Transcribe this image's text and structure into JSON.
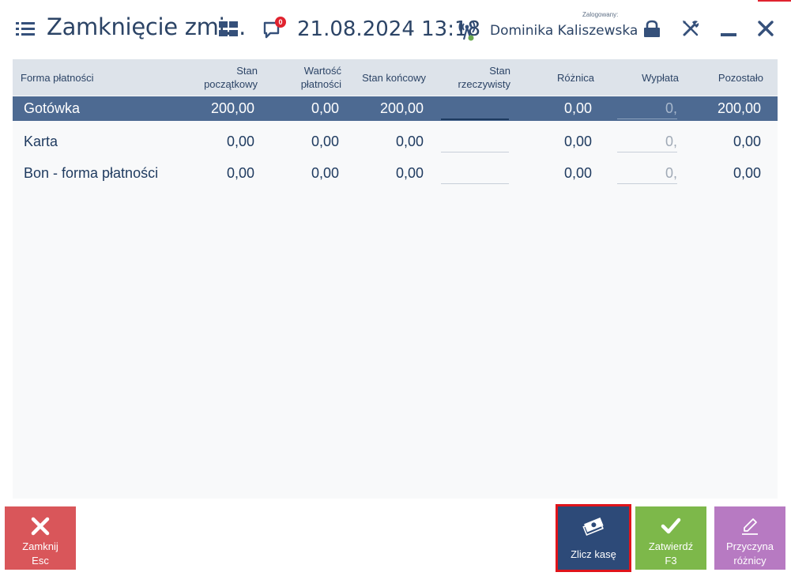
{
  "header": {
    "title": "Zamknięcie zmi...",
    "datetime": "21.08.2024 13:18",
    "notifications_count": "0",
    "logged_label": "Zalogowany:",
    "user_name": "Dominika Kaliszewska",
    "icons": [
      "menu-icon",
      "tiles-icon",
      "notifications-icon",
      "connection-icon",
      "lock-icon",
      "tools-icon",
      "minimize-icon",
      "close-icon"
    ],
    "status_color": "#6aa84f"
  },
  "table": {
    "columns": [
      "Forma płatności",
      "Stan początkowy",
      "Wartość płatności",
      "Stan końcowy",
      "Stan rzeczywisty",
      "Różnica",
      "Wypłata",
      "Pozostało"
    ],
    "column_lines": {
      "stan_poczatkowy": [
        "Stan",
        "początkowy"
      ],
      "wartosc_platnosci": [
        "Wartość",
        "płatności"
      ],
      "stan_rzeczywisty": [
        "Stan",
        "rzeczywisty"
      ]
    },
    "rows": [
      {
        "forma": "Gotówka",
        "stan_poczatkowy": "200,00",
        "wartosc_platnosci": "0,00",
        "stan_koncowy": "200,00",
        "stan_rzeczywisty": "",
        "roznica": "0,00",
        "wyplata": "0,",
        "pozostalo": "200,00",
        "selected": true
      },
      {
        "forma": "Karta",
        "stan_poczatkowy": "0,00",
        "wartosc_platnosci": "0,00",
        "stan_koncowy": "0,00",
        "stan_rzeczywisty": "",
        "roznica": "0,00",
        "wyplata": "0,",
        "pozostalo": "0,00",
        "selected": false
      },
      {
        "forma": "Bon - forma płatności",
        "stan_poczatkowy": "0,00",
        "wartosc_platnosci": "0,00",
        "stan_koncowy": "0,00",
        "stan_rzeczywisty": "",
        "roznica": "0,00",
        "wyplata": "0,",
        "pozostalo": "0,00",
        "selected": false
      }
    ],
    "selected_row_color": "#4d6a92"
  },
  "buttons": {
    "close": {
      "line1": "Zamknij",
      "line2": "Esc",
      "color": "#d9565a"
    },
    "count": {
      "label": "Zlicz kasę",
      "color": "#2d4a78"
    },
    "confirm": {
      "line1": "Zatwierdź",
      "line2": "F3",
      "color": "#7db84a"
    },
    "reason": {
      "line1": "Przyczyna",
      "line2": "różnicy",
      "color": "#b77ac2"
    }
  }
}
